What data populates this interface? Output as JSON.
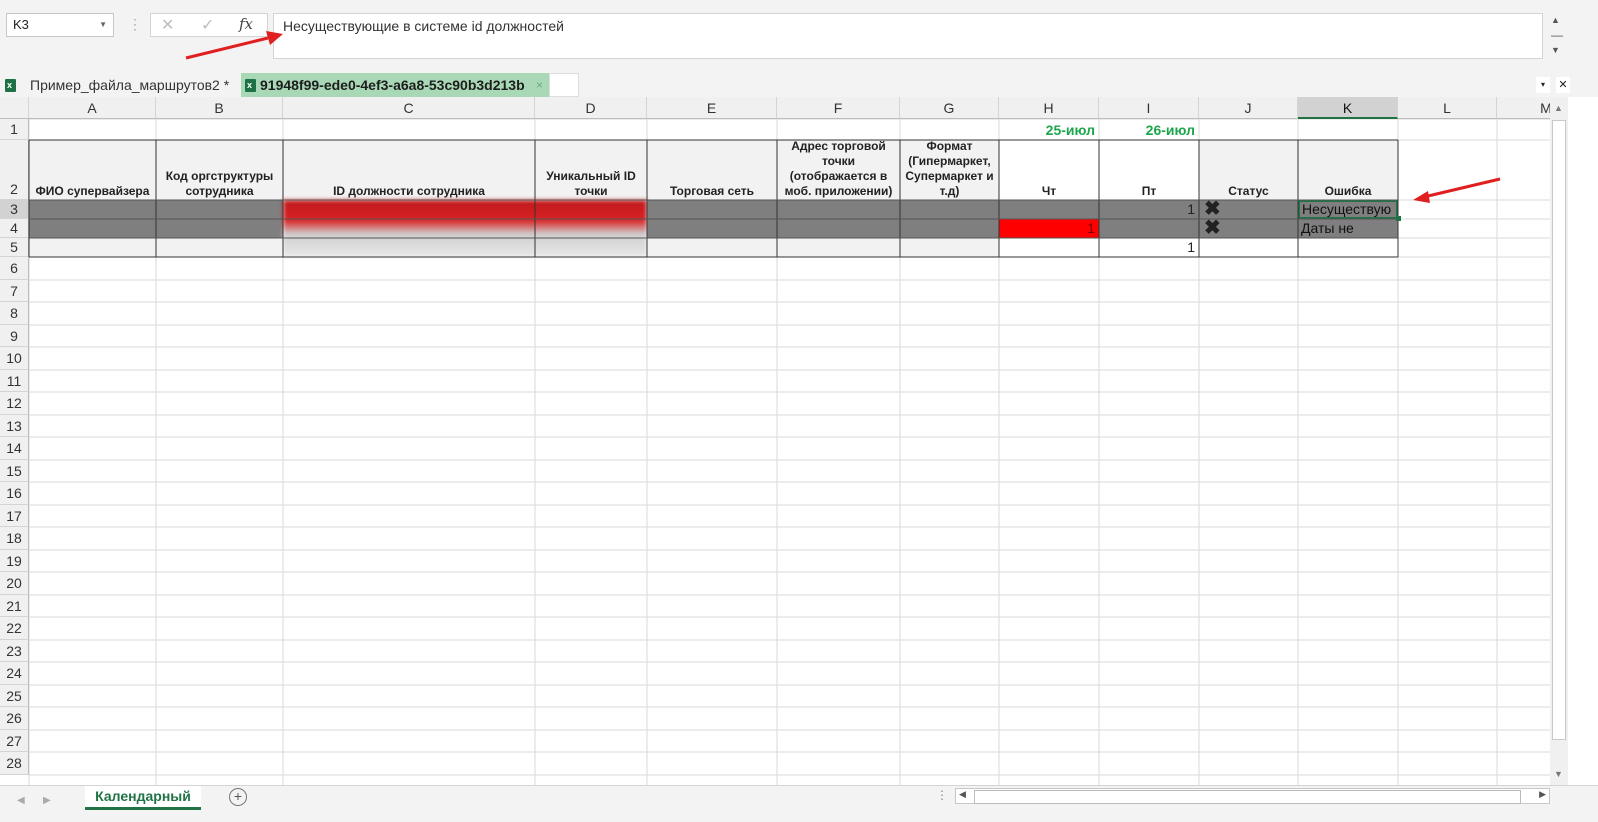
{
  "formula_bar": {
    "name_box": "K3",
    "cancel_icon": "✕",
    "enter_icon": "✓",
    "fx_label": "fx",
    "formula": "Несуществующие в системе id должностей"
  },
  "doc_tabs": [
    {
      "label": "Пример_файла_маршрутов2 *"
    },
    {
      "label": "91948f99-ede0-4ef3-a6a8-53c90b3d213b",
      "close": "×"
    }
  ],
  "tab_controls": {
    "dropdown": "▾",
    "close": "✕"
  },
  "columns": [
    "A",
    "B",
    "C",
    "D",
    "E",
    "F",
    "G",
    "H",
    "I",
    "J",
    "K",
    "L",
    "M"
  ],
  "selected_column": "K",
  "rows": [
    "1",
    "2",
    "3",
    "4",
    "5",
    "6",
    "7",
    "8",
    "9",
    "10",
    "11",
    "12",
    "13",
    "14",
    "15",
    "16",
    "17",
    "18",
    "19",
    "20",
    "21",
    "22",
    "23",
    "24",
    "25",
    "26",
    "27",
    "28"
  ],
  "selected_row": "3",
  "dates": {
    "h1": "25-июл",
    "i1": "26-июл"
  },
  "headers": {
    "a": "ФИО супервайзера",
    "b": "Код оргструктуры сотрудника",
    "c": "ID должности сотрудника",
    "d": "Уникальный ID точки",
    "e": "Торговая сеть",
    "f": "Адрес торговой точки (отображается в моб. приложении)",
    "g": "Формат (Гипермаркет, Супермаркет и т.д)",
    "h": "Чт",
    "i": "Пт",
    "j": "Статус",
    "k": "Ошибка"
  },
  "row3": {
    "i": "1",
    "j": "✖",
    "k": "Несуществую"
  },
  "row4": {
    "h": "1",
    "j": "✖",
    "k": "Даты не"
  },
  "row5": {
    "i": "1"
  },
  "colors": {
    "accent": "#217346",
    "date_green": "#1da54b",
    "error_red": "#ff0000",
    "annotation_red": "#e02020",
    "row_gray": "#7f7f7f"
  },
  "sheet_bar": {
    "active_sheet": "Календарный",
    "add_icon": "+",
    "nav_prev": "◀",
    "nav_next": "▶"
  }
}
